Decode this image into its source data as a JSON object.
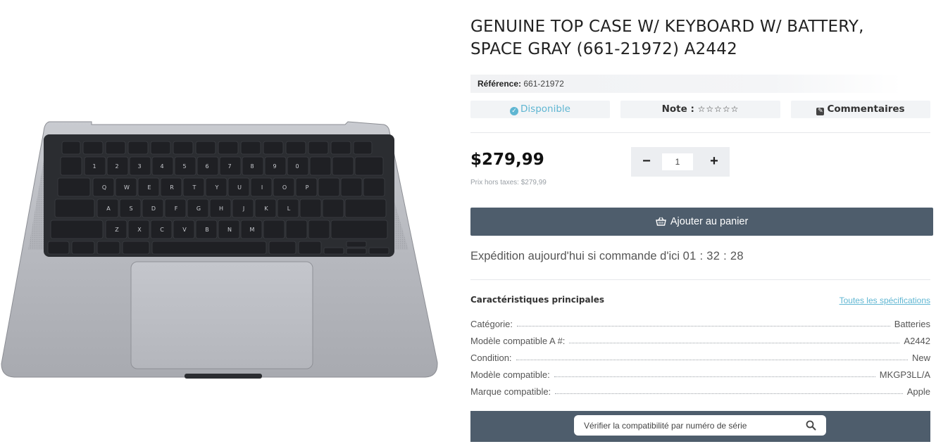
{
  "product": {
    "title": "GENUINE TOP CASE W/ KEYBOARD W/ BATTERY, SPACE GRAY (661-21972) A2442",
    "image_alt": "Genuine top case with keyboard, space gray",
    "reference_label": "Référence:",
    "reference_value": "661-21972"
  },
  "status": {
    "availability": "Disponible",
    "rating_label": "Note :",
    "rating_stars": "☆☆☆☆☆",
    "rating_value": 0,
    "rating_max": 5,
    "comments_label": "Commentaires"
  },
  "pricing": {
    "price": "$279,99",
    "price_ht": "Prix hors taxes: $279,99"
  },
  "quantity": {
    "value": "1",
    "minus": "−",
    "plus": "+"
  },
  "cart": {
    "button_label": "Ajouter au panier"
  },
  "shipping": {
    "text": "Expédition aujourd'hui si commande d'ici",
    "timer": "01 : 32 : 28"
  },
  "specs": {
    "title": "Caractéristiques principales",
    "link": "Toutes les spécifications",
    "rows": [
      {
        "label": "Catégorie:",
        "value": "Batteries"
      },
      {
        "label": "Modèle compatible A #:",
        "value": "A2442"
      },
      {
        "label": "Condition:",
        "value": "New"
      },
      {
        "label": "Modèle compatible:",
        "value": "MKGP3LL/A"
      },
      {
        "label": "Marque compatible:",
        "value": "Apple"
      }
    ]
  },
  "serial_check": {
    "placeholder": "Vérifier la compatibilité par numéro de série"
  },
  "colors": {
    "accent": "#5fb6d2",
    "button": "#4e5d6c",
    "pill_bg": "#f2f4f6"
  },
  "icons": {
    "availability": "check-circle-icon",
    "comments": "edit-icon",
    "cart": "basket-icon",
    "search": "search-icon"
  }
}
